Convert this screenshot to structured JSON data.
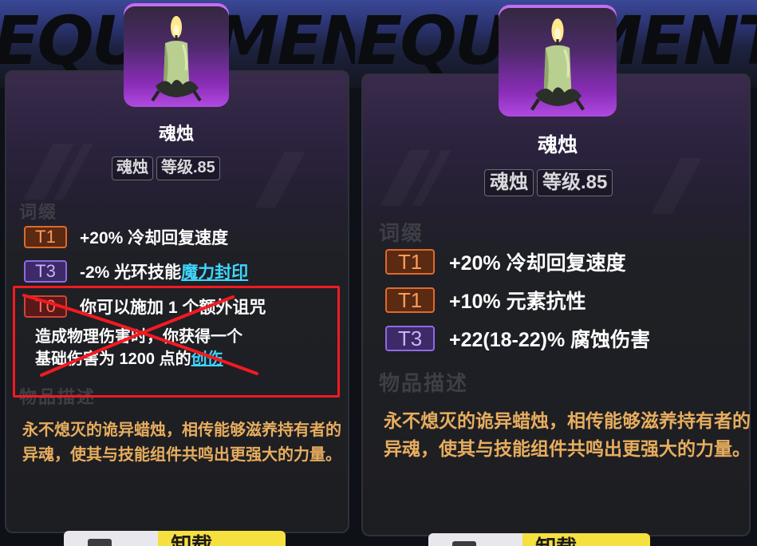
{
  "watermark_text": "EQUIPMENT",
  "colors": {
    "tier1": "#e06a2b",
    "tier3": "#8d6ae6",
    "tier0": "#d04434",
    "link": "#3fd6ff",
    "desc": "#e7ad5e",
    "annotation": "#f11a22"
  },
  "left_card": {
    "icon": "candle-icon",
    "title": "魂烛",
    "tags": [
      "魂烛",
      "等级.85"
    ],
    "affix_heading": "词缀",
    "affixes": [
      {
        "tier": "T1",
        "text": "+20% 冷却回复速度",
        "link": ""
      },
      {
        "tier": "T3",
        "text": "-2% 光环技能",
        "link": "魔力封印"
      },
      {
        "tier": "T0",
        "text": "你可以施加 1 个额外诅咒",
        "link": ""
      }
    ],
    "t0_extra": {
      "line1": "造成物理伤害时，你获得一个",
      "line2": "基础伤害为 1200  点的",
      "link": "创伤"
    },
    "desc_heading": "物品描述",
    "description": "永不熄灭的诡异蜡烛，相传能够滋养持有者的异魂，使其与技能组件共鸣出更强大的力量。",
    "yellow_button": "卸载"
  },
  "right_card": {
    "icon": "candle-icon",
    "title": "魂烛",
    "tags": [
      "魂烛",
      "等级.85"
    ],
    "affix_heading": "词缀",
    "affixes": [
      {
        "tier": "T1",
        "text": "+20% 冷却回复速度"
      },
      {
        "tier": "T1",
        "text": "+10% 元素抗性"
      },
      {
        "tier": "T3",
        "text": "+22(18-22)% 腐蚀伤害"
      }
    ],
    "desc_heading": "物品描述",
    "description": "永不熄灭的诡异蜡烛，相传能够滋养持有者的异魂，使其与技能组件共鸣出更强大的力量。",
    "yellow_button": "卸载"
  }
}
